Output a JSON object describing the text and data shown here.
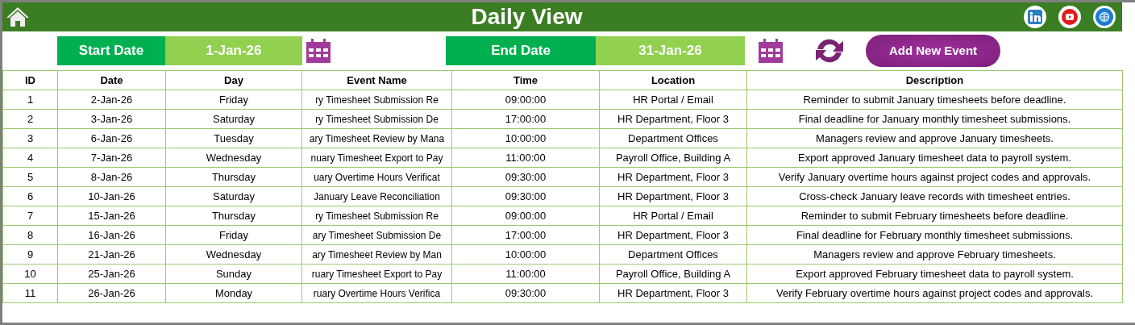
{
  "header": {
    "title": "Daily View"
  },
  "filters": {
    "start_label": "Start Date",
    "start_value": "1-Jan-26",
    "end_label": "End Date",
    "end_value": "31-Jan-26",
    "add_button": "Add New Event"
  },
  "table": {
    "columns": [
      "ID",
      "Date",
      "Day",
      "Event Name",
      "Time",
      "Location",
      "Description"
    ],
    "rows": [
      [
        "1",
        "2-Jan-26",
        "Friday",
        "ry Timesheet Submission Re",
        "09:00:00",
        "HR Portal / Email",
        "Reminder to submit January timesheets before deadline."
      ],
      [
        "2",
        "3-Jan-26",
        "Saturday",
        "ry Timesheet Submission De",
        "17:00:00",
        "HR Department, Floor 3",
        "Final deadline for January monthly timesheet submissions."
      ],
      [
        "3",
        "6-Jan-26",
        "Tuesday",
        "ary Timesheet Review by Mana",
        "10:00:00",
        "Department Offices",
        "Managers review and approve January timesheets."
      ],
      [
        "4",
        "7-Jan-26",
        "Wednesday",
        "nuary Timesheet Export to Pay",
        "11:00:00",
        "Payroll Office, Building A",
        "Export approved January timesheet data to payroll system."
      ],
      [
        "5",
        "8-Jan-26",
        "Thursday",
        "uary Overtime Hours Verificat",
        "09:30:00",
        "HR Department, Floor 3",
        "Verify January overtime hours against project codes and approvals."
      ],
      [
        "6",
        "10-Jan-26",
        "Saturday",
        "January Leave Reconciliation",
        "09:30:00",
        "HR Department, Floor 3",
        "Cross-check January leave records with timesheet entries."
      ],
      [
        "7",
        "15-Jan-26",
        "Thursday",
        "ry Timesheet Submission Re",
        "09:00:00",
        "HR Portal / Email",
        "Reminder to submit February timesheets before deadline."
      ],
      [
        "8",
        "16-Jan-26",
        "Friday",
        "ary Timesheet Submission De",
        "17:00:00",
        "HR Department, Floor 3",
        "Final deadline for February monthly timesheet submissions."
      ],
      [
        "9",
        "21-Jan-26",
        "Wednesday",
        "ary Timesheet Review by Man",
        "10:00:00",
        "Department Offices",
        "Managers review and approve February timesheets."
      ],
      [
        "10",
        "25-Jan-26",
        "Sunday",
        "ruary Timesheet Export to Pay",
        "11:00:00",
        "Payroll Office, Building A",
        "Export approved February timesheet data to payroll system."
      ],
      [
        "11",
        "26-Jan-26",
        "Monday",
        "ruary Overtime Hours Verifica",
        "09:30:00",
        "HR Department, Floor 3",
        "Verify February overtime hours against project codes and approvals."
      ]
    ]
  }
}
